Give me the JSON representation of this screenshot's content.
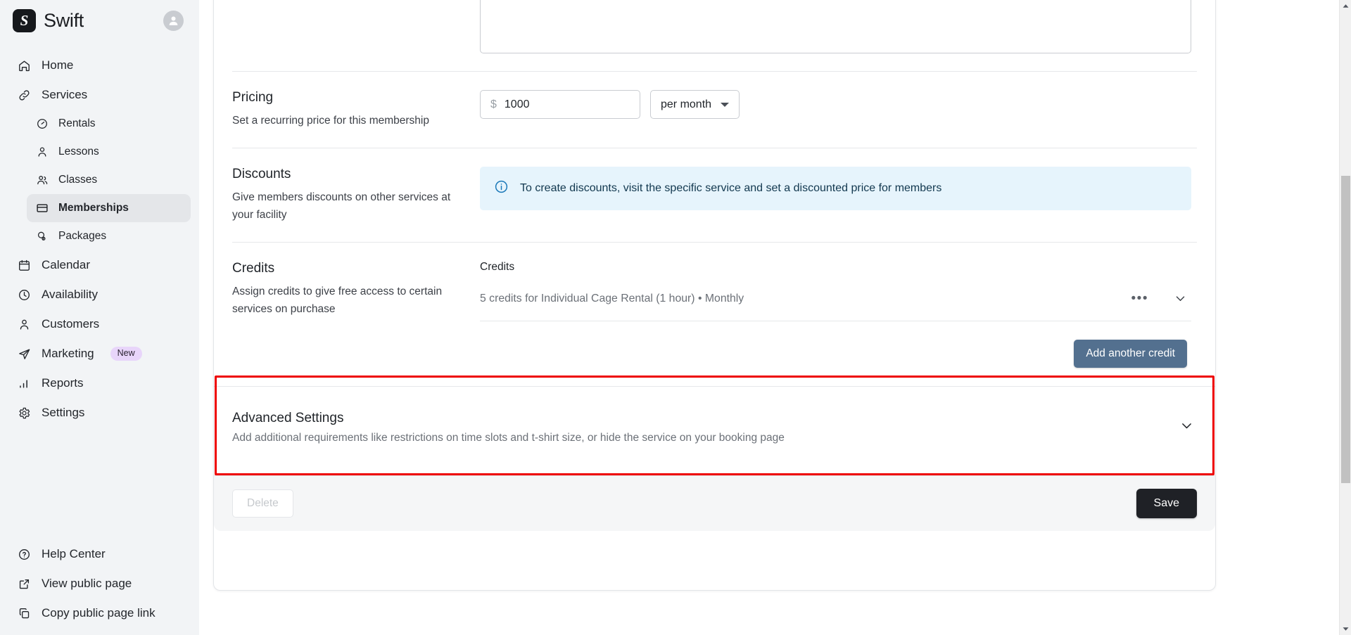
{
  "brand": {
    "name": "Swift",
    "logo_letter": "S",
    "avatar_icon": "user-avatar-icon"
  },
  "sidebar": {
    "items": [
      {
        "label": "Home",
        "icon": "home-icon",
        "level": "top",
        "active": false
      },
      {
        "label": "Services",
        "icon": "link-icon",
        "level": "top",
        "active": false
      },
      {
        "label": "Rentals",
        "icon": "gauge-icon",
        "level": "sub",
        "active": false
      },
      {
        "label": "Lessons",
        "icon": "person-icon",
        "level": "sub",
        "active": false
      },
      {
        "label": "Classes",
        "icon": "people-icon",
        "level": "sub",
        "active": false
      },
      {
        "label": "Memberships",
        "icon": "card-icon",
        "level": "sub",
        "active": true
      },
      {
        "label": "Packages",
        "icon": "coins-icon",
        "level": "sub",
        "active": false
      },
      {
        "label": "Calendar",
        "icon": "calendar-icon",
        "level": "top",
        "active": false
      },
      {
        "label": "Availability",
        "icon": "clock-icon",
        "level": "top",
        "active": false
      },
      {
        "label": "Customers",
        "icon": "person-icon",
        "level": "top",
        "active": false
      },
      {
        "label": "Marketing",
        "icon": "send-icon",
        "level": "top",
        "active": false,
        "badge": "New"
      },
      {
        "label": "Reports",
        "icon": "bar-chart-icon",
        "level": "top",
        "active": false
      },
      {
        "label": "Settings",
        "icon": "gear-icon",
        "level": "top",
        "active": false
      }
    ],
    "bottom_items": [
      {
        "label": "Help Center",
        "icon": "question-circle-icon"
      },
      {
        "label": "View public page",
        "icon": "external-link-icon"
      },
      {
        "label": "Copy public page link",
        "icon": "copy-icon"
      }
    ]
  },
  "form": {
    "description_textarea": {
      "value": "",
      "placeholder": ""
    },
    "pricing": {
      "title": "Pricing",
      "description": "Set a recurring price for this membership",
      "currency_symbol": "$",
      "amount": "1000",
      "interval": "per month"
    },
    "discounts": {
      "title": "Discounts",
      "description": "Give members discounts on other services at your facility",
      "info_icon": "info-circle-icon",
      "info_text": "To create discounts, visit the specific service and set a discounted price for members"
    },
    "credits": {
      "title": "Credits",
      "description": "Assign credits to give free access to certain services on purchase",
      "list_header": "Credits",
      "rows": [
        {
          "label": "5 credits for Individual Cage Rental (1 hour) • Monthly",
          "more_icon": "more-horizontal-icon",
          "expand_icon": "chevron-down-icon"
        }
      ],
      "add_button": "Add another credit"
    },
    "advanced": {
      "title": "Advanced Settings",
      "description": "Add additional requirements like restrictions on time slots and t-shirt size, or hide the service on your booking page",
      "expand_icon": "chevron-down-icon"
    },
    "footer": {
      "delete_label": "Delete",
      "save_label": "Save"
    }
  },
  "colors": {
    "highlight_outline": "#ee0000",
    "add_button_bg": "#53708f",
    "save_button_bg": "#1f2126",
    "info_banner_bg": "#e6f4fc",
    "badge_new_bg": "#e8d5fa",
    "sidebar_bg": "#f2f4f6"
  },
  "scrollbar": {
    "up_icon": "scroll-up-arrow-icon",
    "down_icon": "scroll-down-arrow-icon"
  }
}
